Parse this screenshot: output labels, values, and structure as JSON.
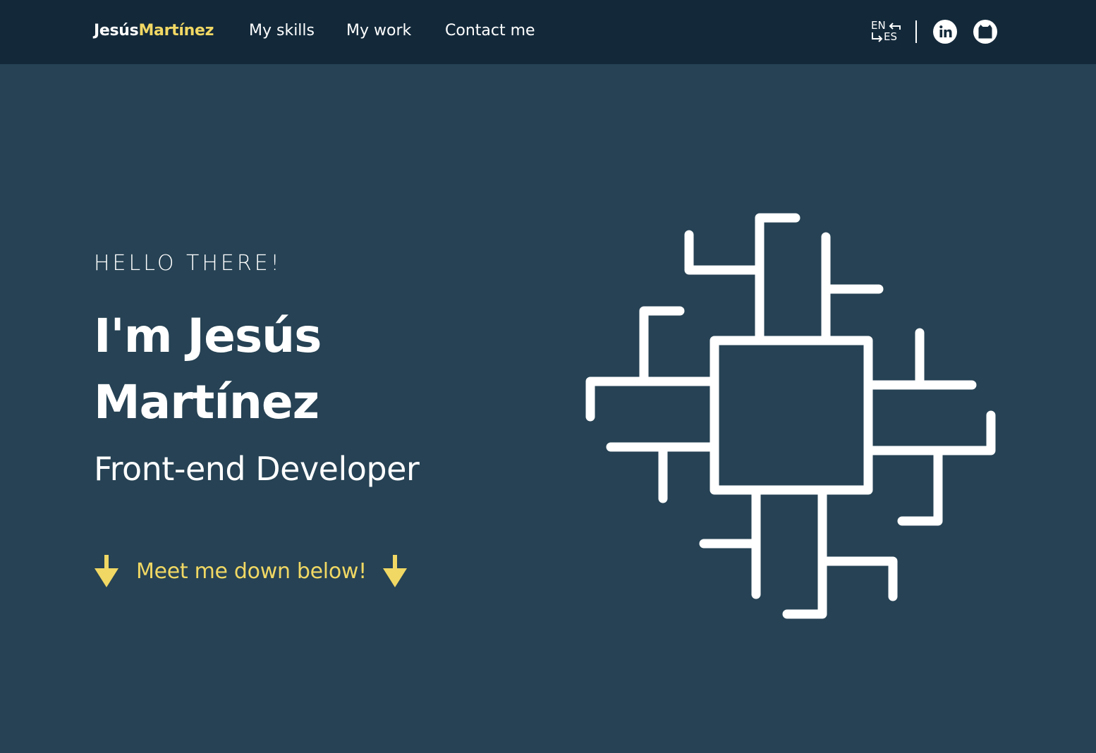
{
  "nav": {
    "brand_first": "Jesús",
    "brand_last": "Martínez",
    "links": [
      "My skills",
      "My work",
      "Contact me"
    ],
    "lang_from": "EN",
    "lang_to": "ES",
    "social_icons": [
      "linkedin-icon",
      "github-icon"
    ]
  },
  "hero": {
    "greeting": "HELLO THERE!",
    "name_line1": "I'm Jesús",
    "name_line2": "Martínez",
    "role": "Front-end Developer",
    "cta": "Meet me down below!",
    "illustration_icon": "circuit-chip-icon"
  },
  "colors": {
    "navbar_bg": "#13293a",
    "page_bg": "#264254",
    "accent": "#f1d864",
    "text": "#ffffff"
  }
}
